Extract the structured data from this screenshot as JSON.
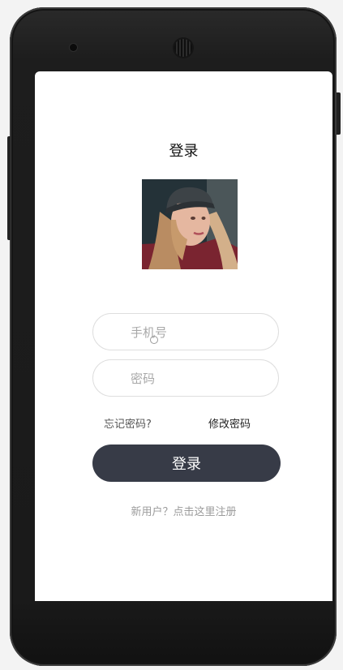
{
  "screen": {
    "title": "登录"
  },
  "form": {
    "phone_placeholder": "手机号",
    "password_placeholder": "密码",
    "forgot_password": "忘记密码?",
    "change_password": "修改密码",
    "login_button": "登录",
    "register_link": "新用户？点击这里注册"
  },
  "colors": {
    "button_bg": "#373b47",
    "button_text": "#ffffff",
    "placeholder": "#a8a8a8",
    "field_border": "#dedede"
  },
  "icons": {
    "avatar": "user-photo",
    "cursor": "touch-cursor-icon"
  }
}
